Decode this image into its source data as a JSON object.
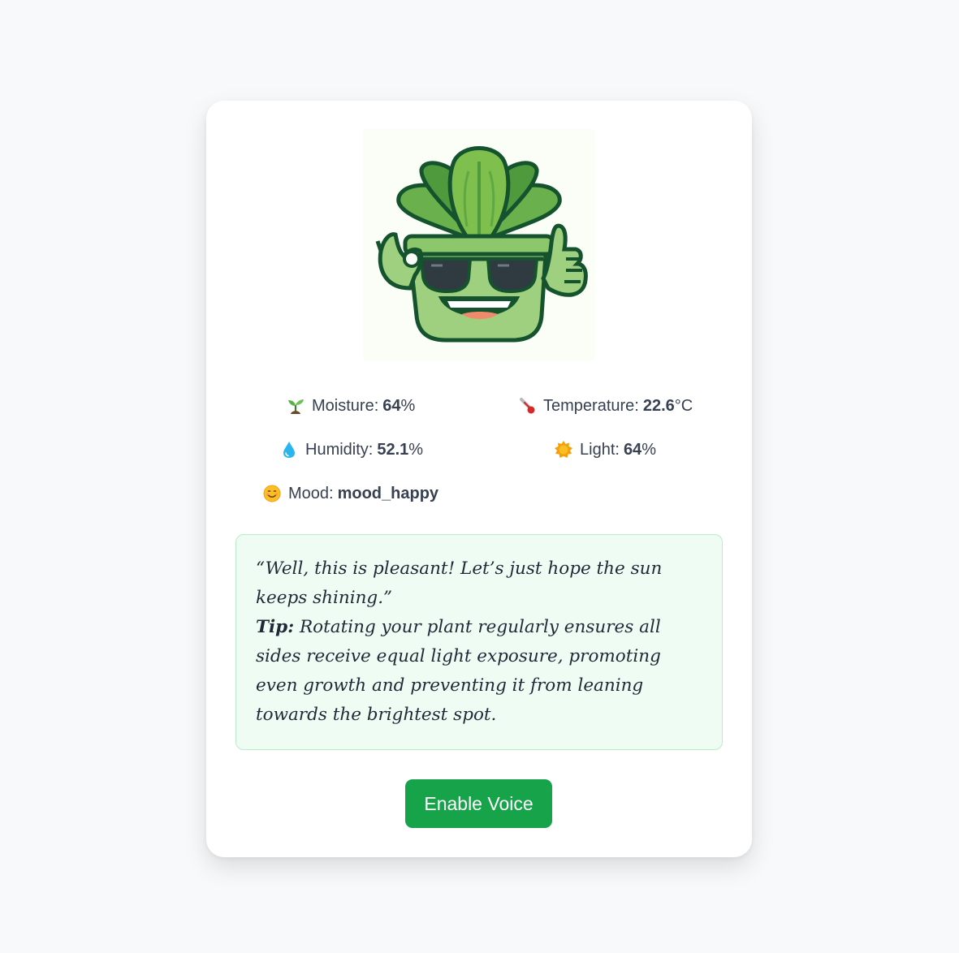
{
  "stats": {
    "moisture": {
      "icon": "seedling-icon",
      "label": "Moisture:",
      "value": "64",
      "unit": "%"
    },
    "temperature": {
      "icon": "thermometer-icon",
      "label": "Temperature:",
      "value": "22.6",
      "unit": "°C"
    },
    "humidity": {
      "icon": "droplet-icon",
      "label": "Humidity:",
      "value": "52.1",
      "unit": "%"
    },
    "light": {
      "icon": "sun-icon",
      "label": "Light:",
      "value": "64",
      "unit": "%"
    },
    "mood": {
      "icon": "smiley-icon",
      "label": "Mood:",
      "value": "mood_happy"
    }
  },
  "message": {
    "quote": "“Well, this is pleasant! Let’s just hope the sun keeps shining.”",
    "tip_label": "Tip:",
    "tip_text": "Rotating your plant regularly ensures all sides receive equal light exposure, promoting even growth and preventing it from leaning towards the brightest spot."
  },
  "actions": {
    "voice_button": "Enable Voice"
  },
  "colors": {
    "accent": "#16a34a",
    "message_bg": "#effcf3",
    "message_border": "#b9ecca",
    "page_bg": "#f8f9fb"
  }
}
